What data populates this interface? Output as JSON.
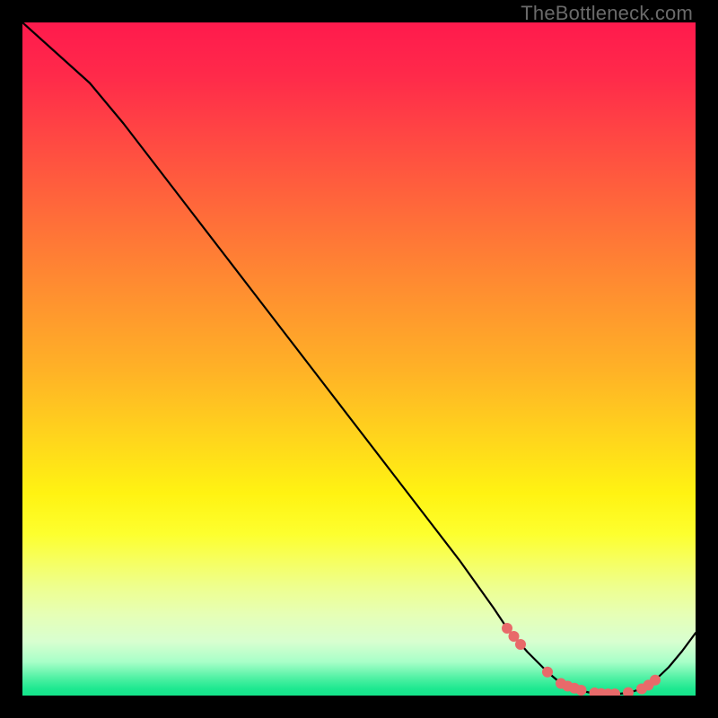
{
  "watermark": "TheBottleneck.com",
  "colors": {
    "frame": "#000000",
    "line": "#000000",
    "marker": "#e86a6a",
    "gradient_top": "#ff1a4d",
    "gradient_mid": "#ffe010",
    "gradient_bottom": "#14e48a"
  },
  "chart_data": {
    "type": "line",
    "title": "",
    "xlabel": "",
    "ylabel": "",
    "xlim": [
      0,
      100
    ],
    "ylim": [
      0,
      100
    ],
    "series": [
      {
        "name": "curve",
        "x": [
          0,
          5,
          10,
          15,
          20,
          25,
          30,
          35,
          40,
          45,
          50,
          55,
          60,
          65,
          70,
          72,
          75,
          78,
          80,
          83,
          85,
          88,
          90,
          92,
          94,
          96,
          98,
          100
        ],
        "y": [
          100,
          95.5,
          91,
          85,
          78.5,
          72,
          65.5,
          59,
          52.5,
          46,
          39.5,
          33,
          26.5,
          20,
          13,
          10,
          6.5,
          3.5,
          1.8,
          0.7,
          0.3,
          0.2,
          0.4,
          1.0,
          2.3,
          4.2,
          6.6,
          9.3
        ]
      }
    ],
    "markers": {
      "name": "highlight-points",
      "x": [
        72,
        73,
        74,
        78,
        80,
        81,
        82,
        83,
        85,
        86,
        87,
        88,
        90,
        92,
        93,
        94
      ],
      "y": [
        10.0,
        8.8,
        7.6,
        3.5,
        1.8,
        1.4,
        1.1,
        0.8,
        0.4,
        0.3,
        0.25,
        0.25,
        0.45,
        1.0,
        1.55,
        2.3
      ]
    }
  }
}
